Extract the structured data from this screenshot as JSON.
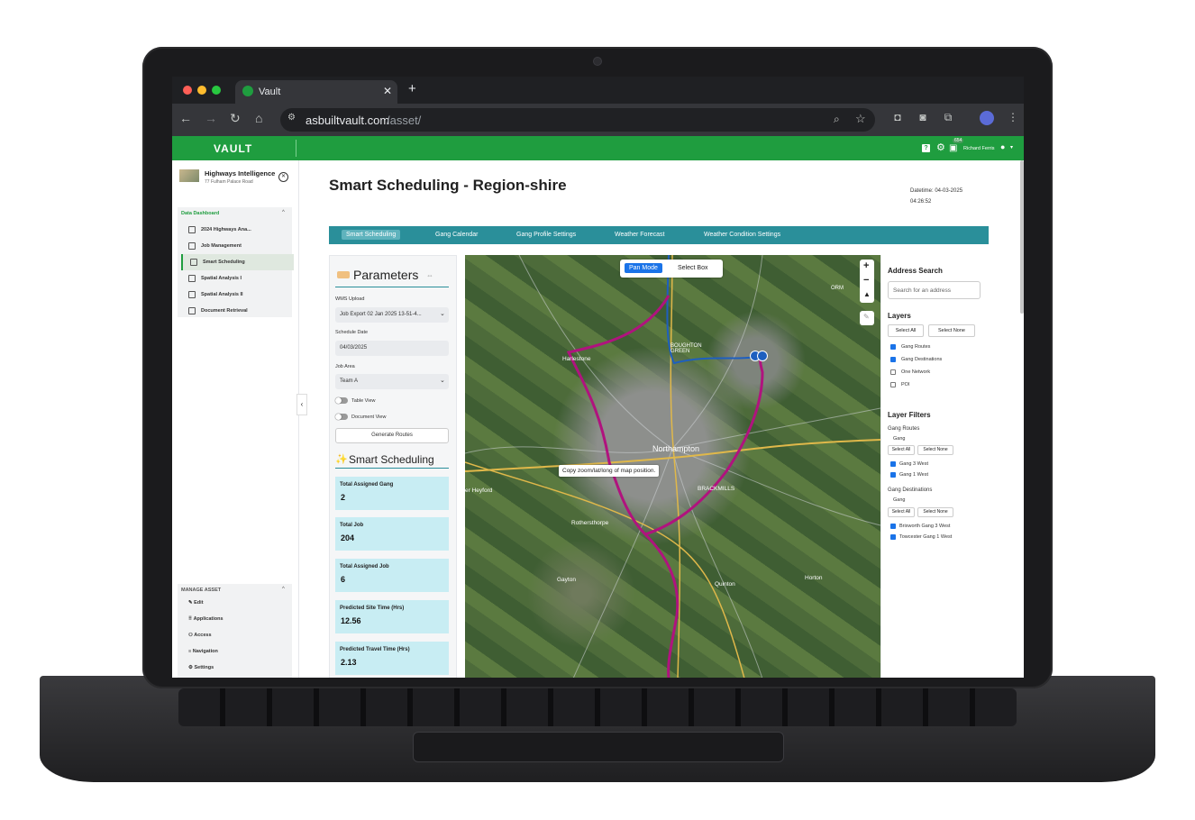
{
  "browser": {
    "tab_title": "Vault",
    "url_host": "asbuiltvault.com",
    "url_path": "/asset/"
  },
  "app": {
    "logo": "VAULT",
    "notif_count": "654",
    "user_name": "Richard Ferris",
    "help_label": "?"
  },
  "org": {
    "name": "Highways Intelligence",
    "address": "77 Fulham Palace Road"
  },
  "sidebar": {
    "section_title": "Data Dashboard",
    "items": [
      {
        "label": "2024 Highways Ana..."
      },
      {
        "label": "Job Management"
      },
      {
        "label": "Smart Scheduling"
      },
      {
        "label": "Spatial Analysis I"
      },
      {
        "label": "Spatial Analysis II"
      },
      {
        "label": "Document Retrieval"
      }
    ],
    "manage_title": "MANAGE ASSET",
    "manage_items": [
      {
        "label": "Edit"
      },
      {
        "label": "Applications"
      },
      {
        "label": "Access"
      },
      {
        "label": "Navigation"
      },
      {
        "label": "Settings"
      }
    ]
  },
  "page": {
    "title": "Smart Scheduling - Region-shire",
    "datetime_label": "Datetime: 04-03-2025",
    "datetime_time": "04:26:52"
  },
  "tabs": [
    "Smart Scheduling",
    "Gang Calendar",
    "Gang Profile Settings",
    "Weather Forecast",
    "Weather Condition Settings"
  ],
  "params": {
    "title": "Parameters",
    "wms_label": "WMS Upload",
    "wms_value": "Job Export 02 Jan 2025 13-51-4...",
    "date_label": "Schedule Date",
    "date_value": "04/03/2025",
    "area_label": "Job Area",
    "area_value": "Team A",
    "toggle_table": "Table View",
    "toggle_doc": "Document View",
    "generate": "Generate Routes"
  },
  "smart": {
    "title": "Smart Scheduling",
    "stats": [
      {
        "label": "Total Assigned Gang",
        "value": "2"
      },
      {
        "label": "Total Job",
        "value": "204"
      },
      {
        "label": "Total Assigned Job",
        "value": "6"
      },
      {
        "label": "Predicted Site Time (Hrs)",
        "value": "12.56"
      },
      {
        "label": "Predicted Travel Time (Hrs)",
        "value": "2.13"
      }
    ]
  },
  "map": {
    "pan_mode": "Pan Mode",
    "select_box": "Select Box",
    "tooltip": "Copy zoom/lat/long of map position.",
    "zoom_in": "+",
    "zoom_out": "−",
    "osm": "ORM",
    "places": [
      "Harlestone",
      "Northampton",
      "BOUGHTON GREEN",
      "Rothersthorpe",
      "Gayton",
      "Quinton",
      "Horton",
      "er Heyford",
      "BRACKMILLS"
    ],
    "road_colors": {
      "route": "#b0137e",
      "major": "#e0b84a",
      "destination": "#1e5fbf"
    }
  },
  "right": {
    "address_title": "Address Search",
    "address_placeholder": "Search for an address",
    "layers_title": "Layers",
    "select_all": "Select All",
    "select_none": "Select None",
    "layers": [
      {
        "label": "Gang Routes",
        "checked": true
      },
      {
        "label": "Gang Destinations",
        "checked": true
      },
      {
        "label": "One Network",
        "checked": false
      },
      {
        "label": "POI",
        "checked": false
      }
    ],
    "filters_title": "Layer Filters",
    "routes_group": "Gang Routes",
    "gang_label": "Gang",
    "routes_items": [
      {
        "label": "Gang 3 West"
      },
      {
        "label": "Gang 1 West"
      }
    ],
    "dest_group": "Gang Destinations",
    "dest_items": [
      {
        "label": "Brixworth Gang 3 West"
      },
      {
        "label": "Towcester Gang 1 West"
      }
    ]
  }
}
